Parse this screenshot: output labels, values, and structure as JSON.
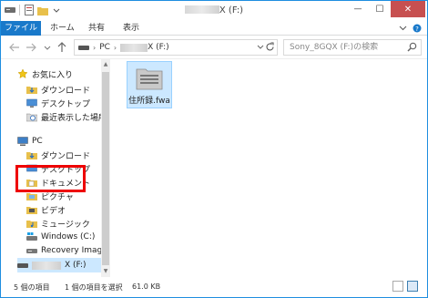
{
  "window": {
    "title_suffix": "X (F:)",
    "controls": {
      "minimize": "—",
      "maximize": "☐",
      "close": "✕"
    }
  },
  "ribbon": {
    "tabs": [
      "ファイル",
      "ホーム",
      "共有",
      "表示"
    ],
    "help": "?"
  },
  "address_bar": {
    "path_root": "PC",
    "drive_suffix": "X (F:)",
    "search_placeholder": "Sony_8GQX (F:)の検索"
  },
  "nav_pane": {
    "favorites": "お気に入り",
    "fav_items": [
      "ダウンロード",
      "デスクトップ",
      "最近表示した場所"
    ],
    "pc": "PC",
    "pc_items": [
      "ダウンロード",
      "デスクトップ",
      "ドキュメント",
      "ピクチャ",
      "ビデオ",
      "ミュージック",
      "Windows  (C:)",
      "Recovery Image"
    ],
    "drive_suffix": "X (F:)"
  },
  "content": {
    "file_name": "住所録.fwa"
  },
  "status_bar": {
    "item_count": "5 個の項目",
    "selected": "1 個の項目を選択",
    "size": "61.0 KB"
  },
  "colors": {
    "accent": "#1979ca",
    "selection": "#cce8ff",
    "highlight_box": "#ee0000"
  }
}
